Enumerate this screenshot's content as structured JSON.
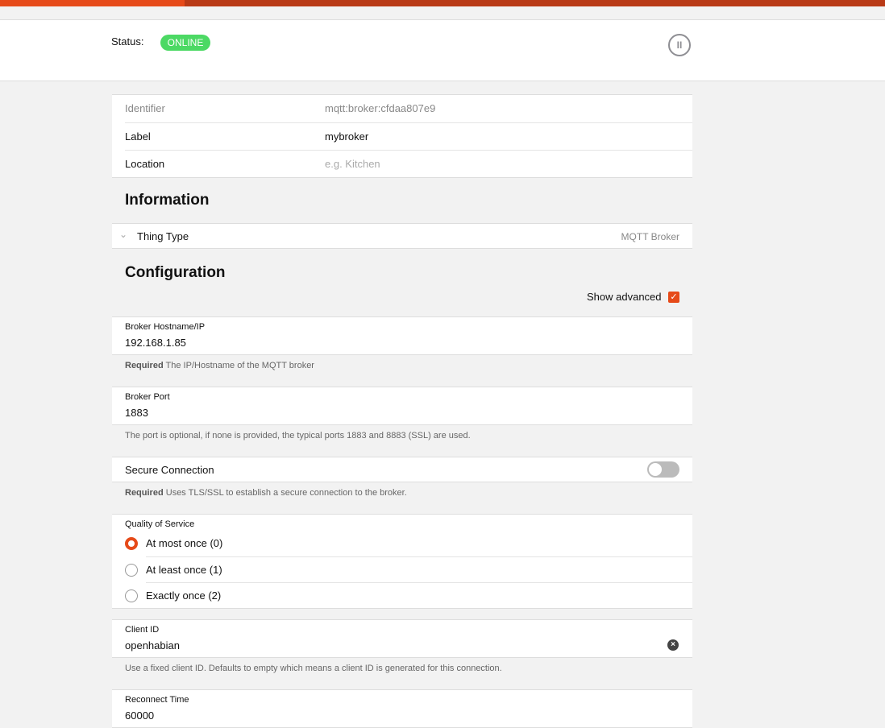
{
  "header": {
    "status_label": "Status:",
    "status": "ONLINE"
  },
  "props": [
    {
      "key": "Identifier",
      "value": "mqtt:broker:cfdaa807e9"
    },
    {
      "key": "Label",
      "value": "mybroker"
    },
    {
      "key": "Location",
      "placeholder": "e.g. Kitchen"
    }
  ],
  "information": {
    "title": "Information",
    "thing_type_label": "Thing Type",
    "thing_type_value": "MQTT Broker"
  },
  "configuration": {
    "title": "Configuration",
    "show_advanced": "Show advanced",
    "show_advanced_checked": true,
    "host": {
      "label": "Broker Hostname/IP",
      "value": "192.168.1.85",
      "req": "Required",
      "help": "The IP/Hostname of the MQTT broker"
    },
    "port": {
      "label": "Broker Port",
      "value": "1883",
      "help": "The port is optional, if none is provided, the typical ports 1883 and 8883 (SSL) are used."
    },
    "secure": {
      "label": "Secure Connection",
      "on": false,
      "req": "Required",
      "help": "Uses TLS/SSL to establish a secure connection to the broker."
    },
    "qos": {
      "label": "Quality of Service",
      "options": [
        "At most once (0)",
        "At least once (1)",
        "Exactly once (2)"
      ],
      "selected": 0
    },
    "client": {
      "label": "Client ID",
      "value": "openhabian",
      "help": "Use a fixed client ID. Defaults to empty which means a client ID is generated for this connection."
    },
    "reconnect": {
      "label": "Reconnect Time",
      "value": "60000"
    }
  },
  "colors": {
    "accent": "#e64a19",
    "online": "#4cd964"
  }
}
